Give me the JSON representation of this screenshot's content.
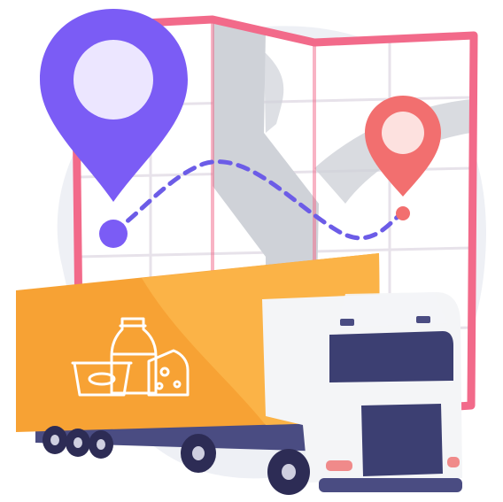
{
  "illustration": {
    "subject": "delivery-truck-with-map-route",
    "icons": [
      "location-pin-icon",
      "map-icon",
      "route-path-icon",
      "delivery-truck-icon",
      "dairy-products-icon"
    ]
  },
  "colors": {
    "background_blob": "#eef0f5",
    "map_frame": "#f26a8a",
    "map_fill": "#ffffff",
    "map_road": "#cfd2d8",
    "map_grid": "#e7e2ea",
    "pin_purple": "#7b5cf5",
    "pin_purple_light": "#ece6ff",
    "pin_coral": "#f26f6f",
    "pin_coral_light": "#fde1df",
    "route": "#6c5ce7",
    "truck_box": "#f7a234",
    "truck_box_light": "#fbb347",
    "truck_cab": "#f4f5f7",
    "truck_window": "#3c3f72",
    "truck_chassis": "#4a4c82",
    "wheel": "#2d2c55",
    "wheel_hub": "#cfcfe0",
    "product_icon_stroke": "#ffffff",
    "headlight": "#f08a8a"
  }
}
